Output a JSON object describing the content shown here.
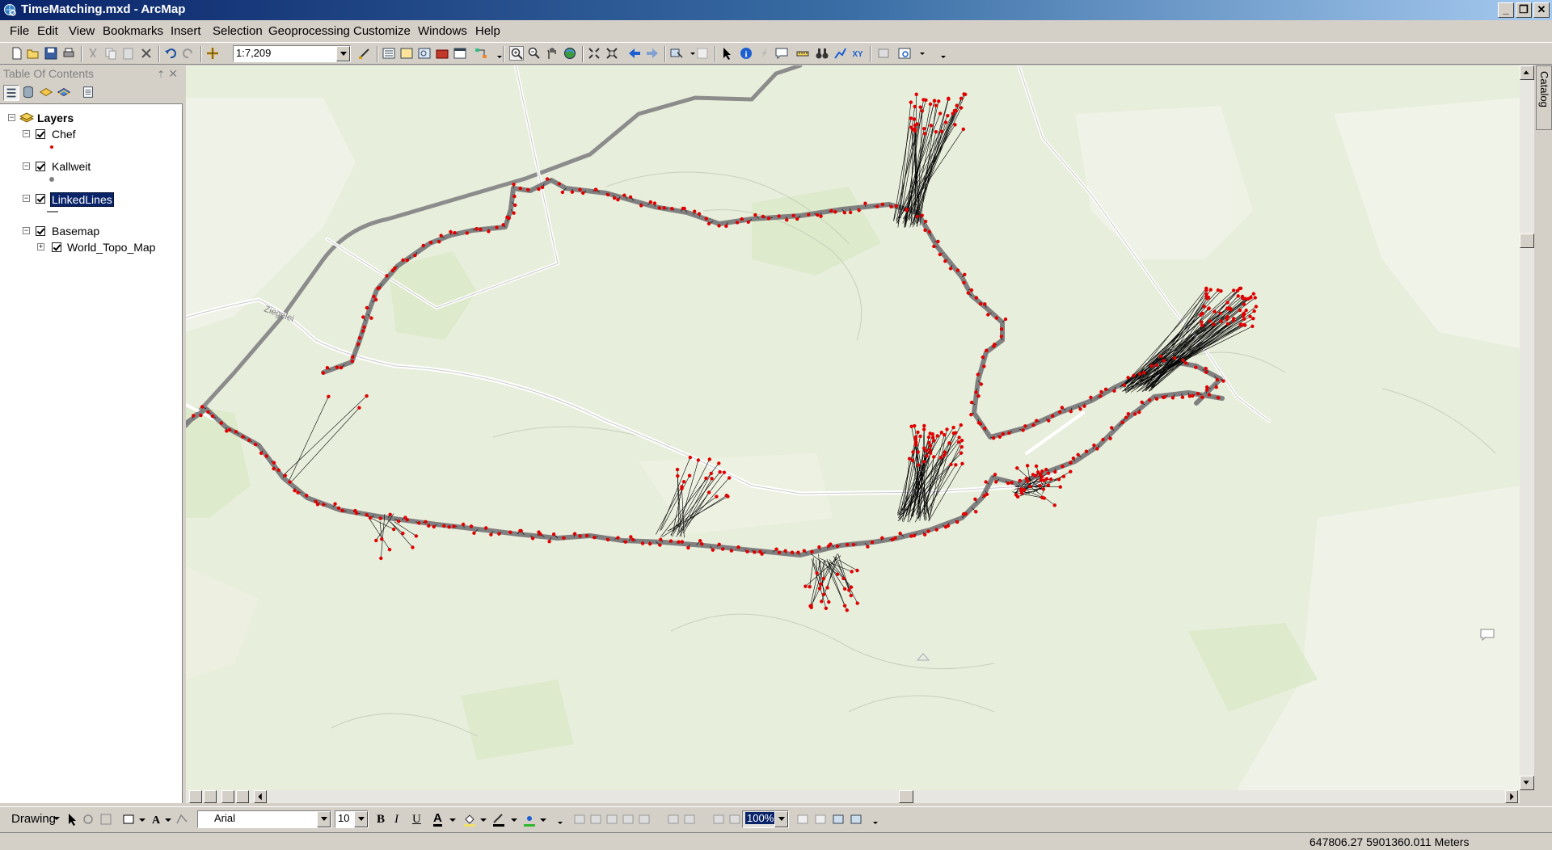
{
  "window": {
    "title": "TimeMatching.mxd - ArcMap",
    "minimize_glyph": "_",
    "maximize_glyph": "❐",
    "close_glyph": "✕"
  },
  "menu": {
    "items": [
      "File",
      "Edit",
      "View",
      "Bookmarks",
      "Insert",
      "Selection",
      "Geoprocessing",
      "Customize",
      "Windows",
      "Help"
    ]
  },
  "toolbar": {
    "scale_value": "1:7,209"
  },
  "toc": {
    "title": "Table Of Contents",
    "pin_glyph": "⇡",
    "close_glyph": "✕",
    "root_label": "Layers",
    "layers": [
      {
        "name": "Chef",
        "symbol": "red-dot",
        "color": "#e00000"
      },
      {
        "name": "Kallweit",
        "symbol": "gray-dot",
        "color": "#808080"
      },
      {
        "name": "LinkedLines",
        "symbol": "black-line",
        "color": "#000000"
      },
      {
        "name": "Basemap",
        "symbol": "group"
      }
    ],
    "sublayer": "World_Topo_Map"
  },
  "catalog_tab": "Catalog",
  "drawing_toolbar": {
    "label": "Drawing",
    "font_value": "Arial",
    "font_size": "10",
    "zoom_value": "100%",
    "bold": "B",
    "italic": "I",
    "underline": "U",
    "font_color_glyph": "A"
  },
  "status": {
    "coordinates": "647806.27  5901360.011 Meters"
  },
  "map": {
    "road_label": "Ziegelei",
    "colors": {
      "background": "#e8eedc",
      "road": "#8c8c8c",
      "track": "#808080",
      "point": "#e00000",
      "link": "#000000"
    }
  }
}
